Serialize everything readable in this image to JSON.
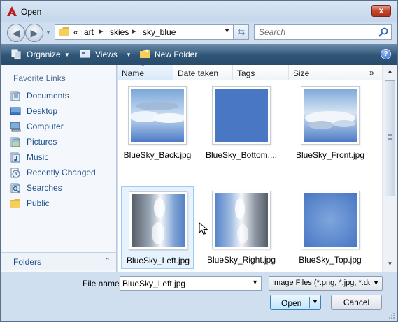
{
  "window": {
    "title": "Open",
    "close_glyph": "x"
  },
  "nav": {
    "back_glyph": "◀",
    "forward_glyph": "▶",
    "breadcrumbs": [
      "art",
      "skies",
      "sky_blue"
    ],
    "overflow_glyph": "«",
    "separator_glyph": "▸",
    "refresh_glyph": "⇆",
    "search_placeholder": "Search"
  },
  "toolbar": {
    "organize_label": "Organize",
    "views_label": "Views",
    "new_folder_label": "New Folder",
    "help_glyph": "?"
  },
  "favorites": {
    "header": "Favorite Links",
    "items": [
      {
        "label": "Documents",
        "icon": "documents-icon"
      },
      {
        "label": "Desktop",
        "icon": "desktop-icon"
      },
      {
        "label": "Computer",
        "icon": "computer-icon"
      },
      {
        "label": "Pictures",
        "icon": "pictures-icon"
      },
      {
        "label": "Music",
        "icon": "music-icon"
      },
      {
        "label": "Recently Changed",
        "icon": "recently-changed-icon"
      },
      {
        "label": "Searches",
        "icon": "searches-icon"
      },
      {
        "label": "Public",
        "icon": "public-folder-icon"
      }
    ],
    "folders_label": "Folders",
    "folders_chevron": "⌃"
  },
  "columns": {
    "headers": [
      "Name",
      "Date taken",
      "Tags",
      "Size"
    ],
    "more_glyph": "»",
    "sort_caret": "^"
  },
  "files": [
    {
      "label": "BlueSky_Back.jpg",
      "kind": "back"
    },
    {
      "label": "BlueSky_Bottom....",
      "kind": "bottom"
    },
    {
      "label": "BlueSky_Front.jpg",
      "kind": "front"
    },
    {
      "label": "BlueSky_Left.jpg",
      "kind": "left",
      "selected": true
    },
    {
      "label": "BlueSky_Right.jpg",
      "kind": "right"
    },
    {
      "label": "BlueSky_Top.jpg",
      "kind": "top"
    }
  ],
  "footer": {
    "file_name_label": "File name:",
    "file_name_value": "BlueSky_Left.jpg",
    "file_type_value": "Image Files (*.png, *.jpg, *.dds",
    "open_label": "Open",
    "cancel_label": "Cancel"
  },
  "colors": {
    "sky_blue": "#4a77c4",
    "link_blue": "#1a4f8a",
    "toolbar_dark": "#2f5576"
  }
}
